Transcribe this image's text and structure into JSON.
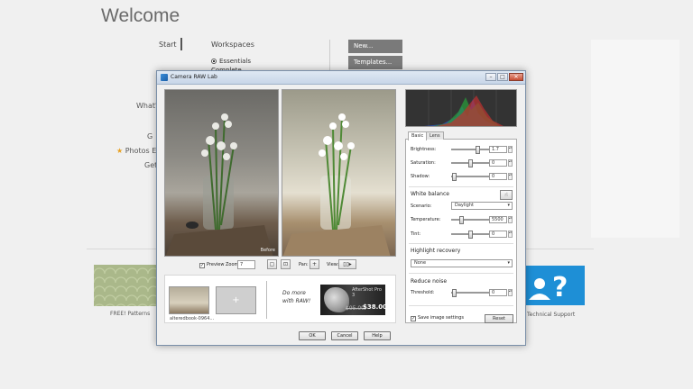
{
  "welcome": {
    "title": "Welcome",
    "start": "Start",
    "workspaces": "Workspaces",
    "essentials": "Essentials",
    "complete": "Complete",
    "new_button": "New...",
    "templates_button": "Templates...",
    "whats_new": "What's",
    "side_g": "G",
    "photos_events": "Photos Ev",
    "get": "Get",
    "free_patterns": "FREE! Patterns",
    "technical_support": "Technical Support"
  },
  "dialog": {
    "title": "Camera RAW Lab",
    "before_label": "Before",
    "preview_label": "Preview",
    "zoom_label": "Zoom:",
    "zoom_value": "7",
    "pan_label": "Pan:",
    "view_label": "View:",
    "thumb_label": "alteredbook-0964...",
    "thumb_add": "+",
    "promo_line1": "Do more",
    "promo_line2": "with RAW!",
    "promo_product": "AfterShot Pro 3",
    "promo_old_price": "$95.00",
    "promo_new_price": "$38.00",
    "ok": "OK",
    "cancel": "Cancel",
    "help": "Help"
  },
  "panel": {
    "tabs": [
      "Basic",
      "Lens"
    ],
    "brightness": {
      "label": "Brightness:",
      "value": "1.7"
    },
    "saturation": {
      "label": "Saturation:",
      "value": "0"
    },
    "shadow": {
      "label": "Shadow:",
      "value": "0"
    },
    "white_balance": "White balance",
    "scenario_label": "Scenario:",
    "scenario_value": "Daylight",
    "temperature": {
      "label": "Temperature:",
      "value": "5500"
    },
    "tint": {
      "label": "Tint:",
      "value": "0"
    },
    "highlight_recovery": "Highlight recovery",
    "highlight_value": "None",
    "reduce_noise": "Reduce noise",
    "threshold": {
      "label": "Threshold:",
      "value": "0"
    },
    "save_settings": "Save image settings",
    "reset": "Reset"
  },
  "colors": {
    "accent": "#1e8fd6",
    "histogram_bg": "#333333"
  }
}
